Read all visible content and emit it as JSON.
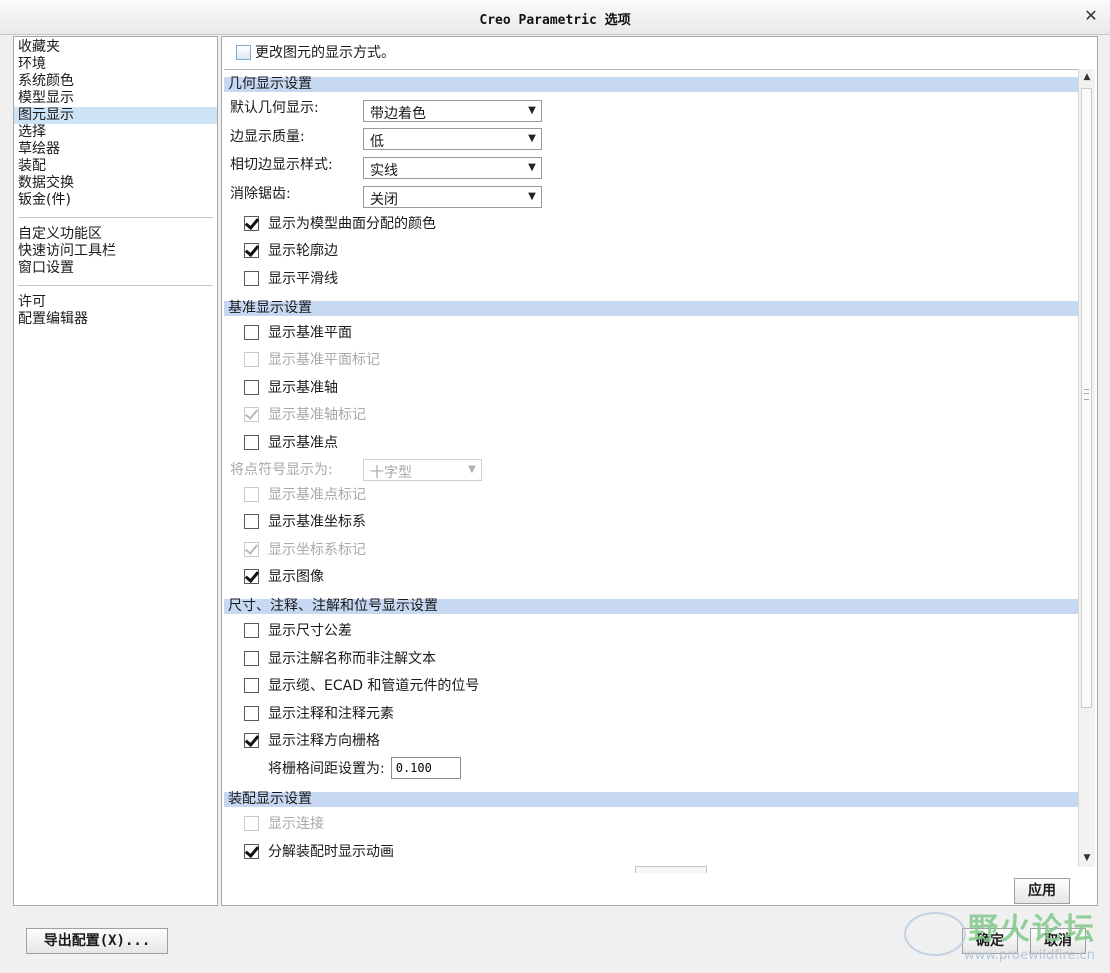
{
  "window": {
    "title": "Creo Parametric 选项"
  },
  "nav": {
    "group1": [
      "收藏夹",
      "环境",
      "系统颜色",
      "模型显示",
      "图元显示",
      "选择",
      "草绘器",
      "装配",
      "数据交换",
      "钣金(件)"
    ],
    "group2": [
      "自定义功能区",
      "快速访问工具栏",
      "窗口设置"
    ],
    "group3": [
      "许可",
      "配置编辑器"
    ],
    "selected": "图元显示"
  },
  "panel": {
    "header": "更改图元的显示方式。",
    "geometry": {
      "title": "几何显示设置",
      "default_display_label": "默认几何显示:",
      "default_display_value": "带边着色",
      "edge_quality_label": "边显示质量:",
      "edge_quality_value": "低",
      "tangent_style_label": "相切边显示样式:",
      "tangent_style_value": "实线",
      "antialias_label": "消除锯齿:",
      "antialias_value": "关闭",
      "cb_surface_colors": "显示为模型曲面分配的颜色",
      "cb_silhouette": "显示轮廓边",
      "cb_smooth_lines": "显示平滑线"
    },
    "datum": {
      "title": "基准显示设置",
      "cb_planes": "显示基准平面",
      "cb_plane_tags": "显示基准平面标记",
      "cb_axes": "显示基准轴",
      "cb_axis_tags": "显示基准轴标记",
      "cb_points": "显示基准点",
      "point_symbol_label": "将点符号显示为:",
      "point_symbol_value": "十字型",
      "cb_point_tags": "显示基准点标记",
      "cb_csys": "显示基准坐标系",
      "cb_csys_tags": "显示坐标系标记",
      "cb_images": "显示图像"
    },
    "dimension": {
      "title": "尺寸、注释、注解和位号显示设置",
      "cb_tolerances": "显示尺寸公差",
      "cb_annotation_names": "显示注解名称而非注解文本",
      "cb_cable_ecad": "显示缆、ECAD 和管道元件的位号",
      "cb_annotation_elements": "显示注释和注释元素",
      "cb_orientation_grid": "显示注释方向栅格",
      "grid_spacing_label": "将栅格间距设置为:",
      "grid_spacing_value": "0.100"
    },
    "assembly": {
      "title": "装配显示设置",
      "cb_connections": "显示连接",
      "cb_explode_anim": "分解装配时显示动画"
    }
  },
  "buttons": {
    "apply": "应用",
    "export": "导出配置(X)...",
    "ok": "确定",
    "cancel": "取消"
  },
  "watermark": {
    "text": "野火论坛",
    "url": "www.proewildfire.cn"
  },
  "colors": {
    "section_bg": "#c6d8f2",
    "nav_selected": "#cde4f7",
    "watermark_green": "#82c98a"
  }
}
